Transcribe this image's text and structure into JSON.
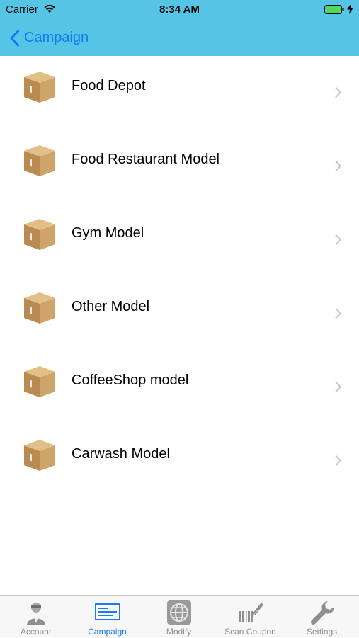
{
  "status_bar": {
    "carrier": "Carrier",
    "time": "8:34 AM"
  },
  "nav": {
    "back_label": "Campaign"
  },
  "list": {
    "items": [
      {
        "label": "Food Depot"
      },
      {
        "label": "Food Restaurant Model"
      },
      {
        "label": "Gym Model"
      },
      {
        "label": "Other Model"
      },
      {
        "label": "CoffeeShop model"
      },
      {
        "label": "Carwash Model"
      }
    ]
  },
  "tab_bar": {
    "active": "Campaign",
    "tabs": [
      {
        "label": "Account",
        "icon": "account-icon"
      },
      {
        "label": "Campaign",
        "icon": "campaign-icon"
      },
      {
        "label": "Modify",
        "icon": "globe-icon"
      },
      {
        "label": "Scan Coupon",
        "icon": "barcode-scanner-icon"
      },
      {
        "label": "Settings",
        "icon": "wrench-icon"
      }
    ]
  },
  "colors": {
    "bar": "#55c4e5",
    "accent": "#1479f8",
    "tab_active": "#1a7cf5",
    "tab_inactive": "#8e8e8e"
  }
}
